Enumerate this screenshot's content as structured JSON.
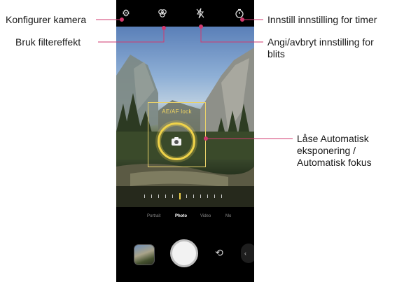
{
  "callouts": {
    "configure_camera": "Konfigurer kamera",
    "filter_effect": "Bruk filtereffekt",
    "timer_setting": "Innstill innstilling for timer",
    "flash_setting": "Angi/avbryt innstilling for blits",
    "ae_af_lock": "Låse Automatisk eksponering / Automatisk fokus"
  },
  "viewfinder": {
    "af_lock_label": "AE/AF lock"
  },
  "modes": [
    "Portrait",
    "Photo",
    "Video",
    "Mo"
  ],
  "icons": {
    "settings": "gear-icon",
    "filter": "filter-icon",
    "flash": "flash-off-icon",
    "timer": "timer-icon",
    "camera": "camera-icon",
    "switch": "switch-camera-icon",
    "drawer": "chevron-left-icon"
  },
  "colors": {
    "callout_line": "#d23a6f",
    "af_accent": "#f0d34a"
  }
}
